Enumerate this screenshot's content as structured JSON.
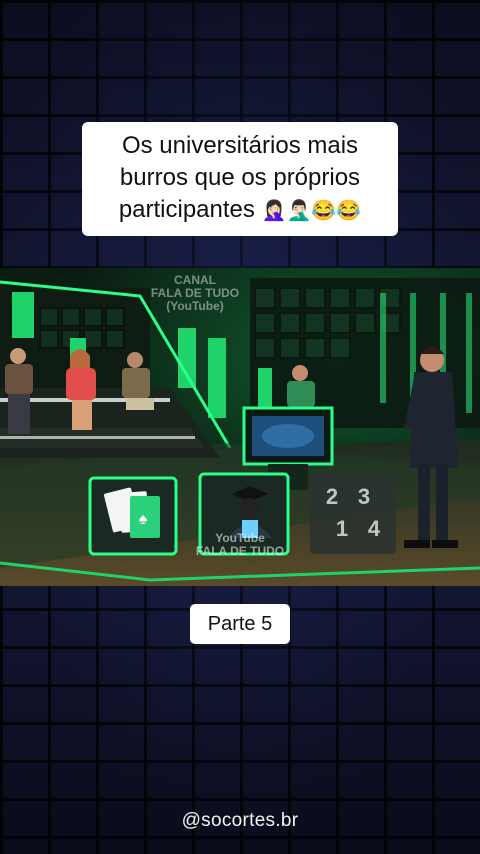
{
  "caption": {
    "line1": "Os universitários mais",
    "line2": "burros que os próprios",
    "line3": "participantes",
    "emojis": "🤦🏻‍♀️🤦🏻‍♂️😂😂"
  },
  "video": {
    "watermark_top": [
      "CANAL",
      "FALA DE TUDO",
      "(YouTube)"
    ],
    "watermark_bottom": [
      "YouTube",
      "FALA DE TUDO"
    ],
    "cards": [
      "playing-cards-icon",
      "graduate-icon",
      "numbers-icon"
    ],
    "colors": {
      "studio_green": "#1fd36a",
      "accent": "#2bff8a"
    }
  },
  "badge": {
    "label": "Parte 5"
  },
  "handle": "@socortes.br"
}
